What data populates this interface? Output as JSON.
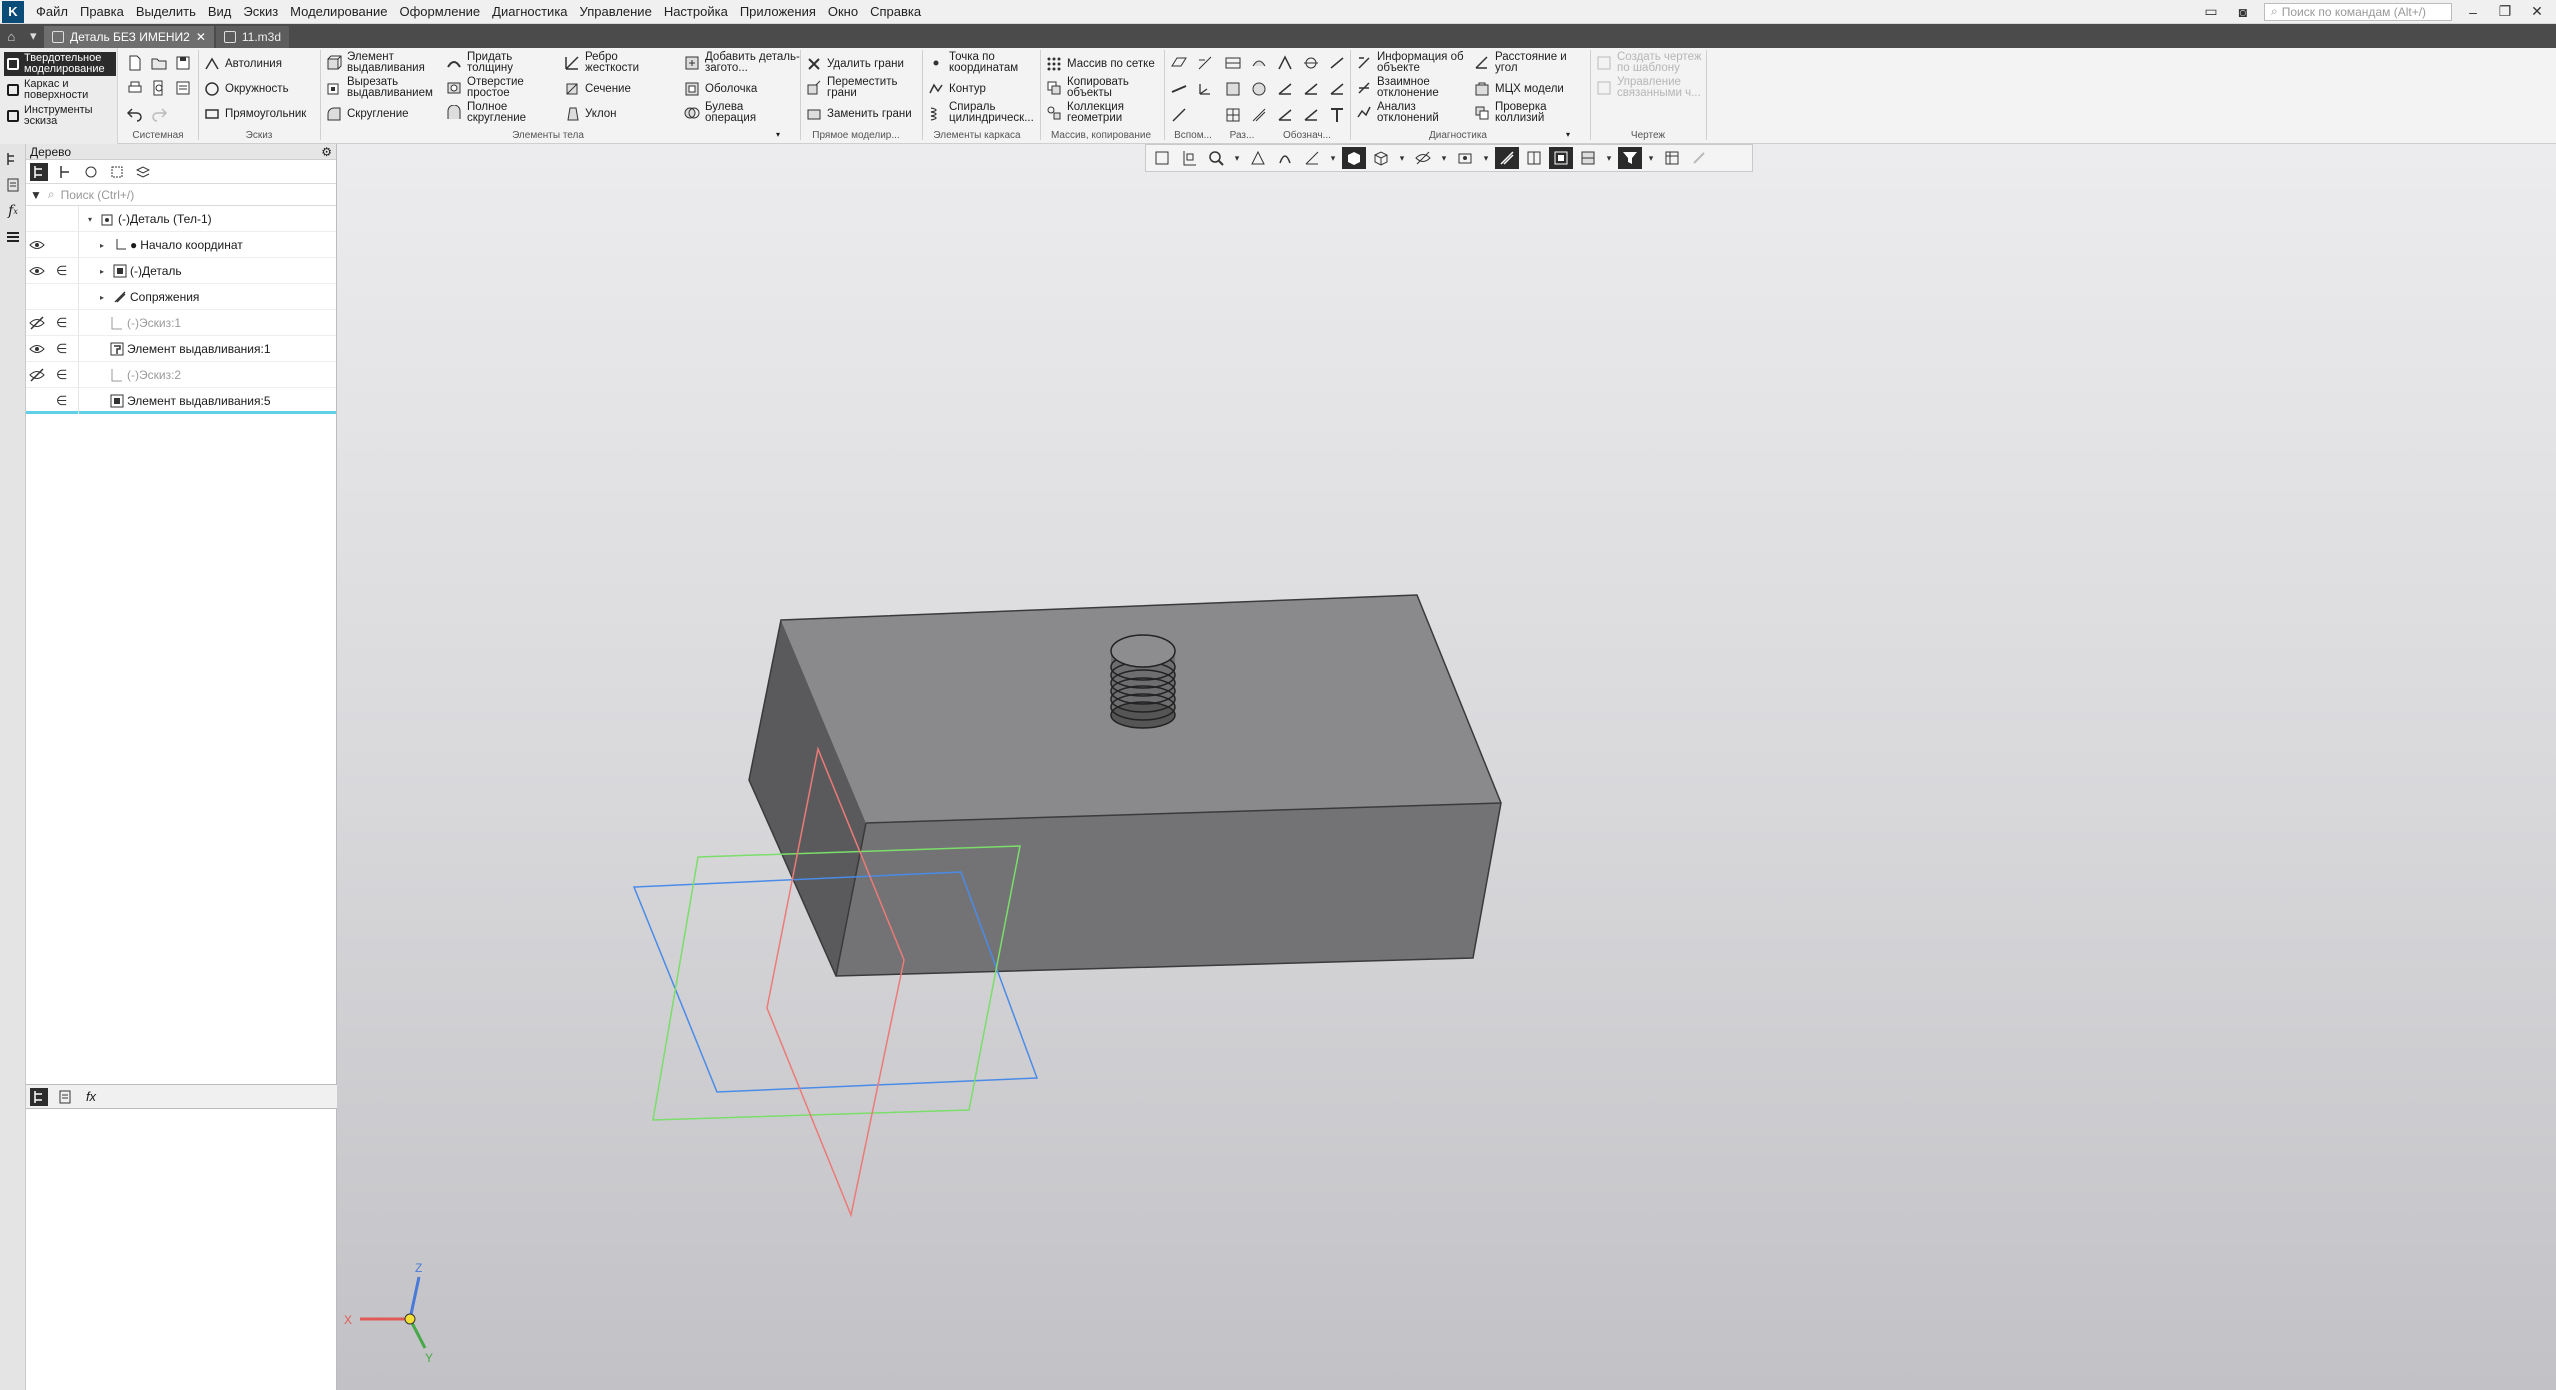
{
  "menu": {
    "items": [
      "Файл",
      "Правка",
      "Выделить",
      "Вид",
      "Эскиз",
      "Моделирование",
      "Оформление",
      "Диагностика",
      "Управление",
      "Настройка",
      "Приложения",
      "Окно",
      "Справка"
    ],
    "command_search_placeholder": "Поиск по командам (Alt+/)"
  },
  "tabs": [
    {
      "label": "Деталь БЕЗ ИМЕНИ2",
      "active": true
    },
    {
      "label": "11.m3d",
      "active": false
    }
  ],
  "ribbon": {
    "modes": [
      "Твердотельное моделирование",
      "Каркас и поверхности",
      "Инструменты эскиза"
    ],
    "sketch": {
      "autoline": "Автолиния",
      "circle": "Окружность",
      "rectangle": "Прямоугольник"
    },
    "body": {
      "extrude": "Элемент выдавливания",
      "cut_extrude": "Вырезать выдавливанием",
      "fillet": "Скругление",
      "thicken": "Придать толщину",
      "simple_hole": "Отверстие простое",
      "full_round": "Полное скругление",
      "rib": "Ребро жесткости",
      "section": "Сечение",
      "draft": "Уклон",
      "add_stock": "Добавить деталь-загото...",
      "shell": "Оболочка",
      "boolean": "Булева операция"
    },
    "direct": {
      "delete_faces": "Удалить грани",
      "move_faces": "Переместить грани",
      "replace_faces": "Заменить грани"
    },
    "frame": {
      "point_by_coords": "Точка по координатам",
      "contour": "Контур",
      "spiral": "Спираль цилиндрическ..."
    },
    "arrays": {
      "grid_array": "Массив по сетке",
      "copy_objects": "Копировать объекты",
      "geometry_collection": "Коллекция геометрии"
    },
    "diagnostics": {
      "object_info": "Информация об объекте",
      "distance_angle": "Расстояние и угол",
      "mutual_deviation": "Взаимное отклонение",
      "mass_props": "МЦХ модели",
      "deviation_analysis": "Анализ отклонений",
      "collision_check": "Проверка коллизий"
    },
    "drawing": {
      "create_drawing": "Создать чертеж по шаблону",
      "manage_linked": "Управление связанными ч..."
    },
    "group_labels": {
      "system": "Системная",
      "sketch": "Эскиз",
      "body": "Элементы тела",
      "direct": "Прямое моделир...",
      "frame": "Элементы каркаса",
      "arrays": "Массив, копирование",
      "aux": "Вспом...",
      "dims": "Раз...",
      "notation": "Обознач...",
      "diagnostics": "Диагностика",
      "drawing": "Чертеж"
    }
  },
  "tree_panel": {
    "title": "Дерево",
    "search_placeholder": "Поиск (Ctrl+/)",
    "rows": [
      {
        "label": "(-)Деталь (Тел-1)",
        "eye": "",
        "rel": ""
      },
      {
        "label": "Начало координат",
        "eye": "visible",
        "rel": ""
      },
      {
        "label": "(-)Деталь",
        "eye": "visible",
        "rel": "∈"
      },
      {
        "label": "Сопряжения",
        "eye": "",
        "rel": ""
      },
      {
        "label": "(-)Эскиз:1",
        "eye": "hidden",
        "rel": "∈"
      },
      {
        "label": "Элемент выдавливания:1",
        "eye": "visible",
        "rel": "∈"
      },
      {
        "label": "(-)Эскиз:2",
        "eye": "hidden",
        "rel": "∈"
      },
      {
        "label": "Элемент выдавливания:5",
        "eye": "",
        "rel": "∈"
      }
    ]
  },
  "viewport": {
    "triad": {
      "x": "X",
      "y": "Y",
      "z": "Z"
    },
    "colors": {
      "plane_xy": "#4a8be8",
      "plane_zx": "#7bdd6a",
      "plane_zy": "#ec7a78",
      "body_top": "#8a8a8c",
      "body_front": "#737375",
      "body_side": "#5a5a5c"
    }
  }
}
